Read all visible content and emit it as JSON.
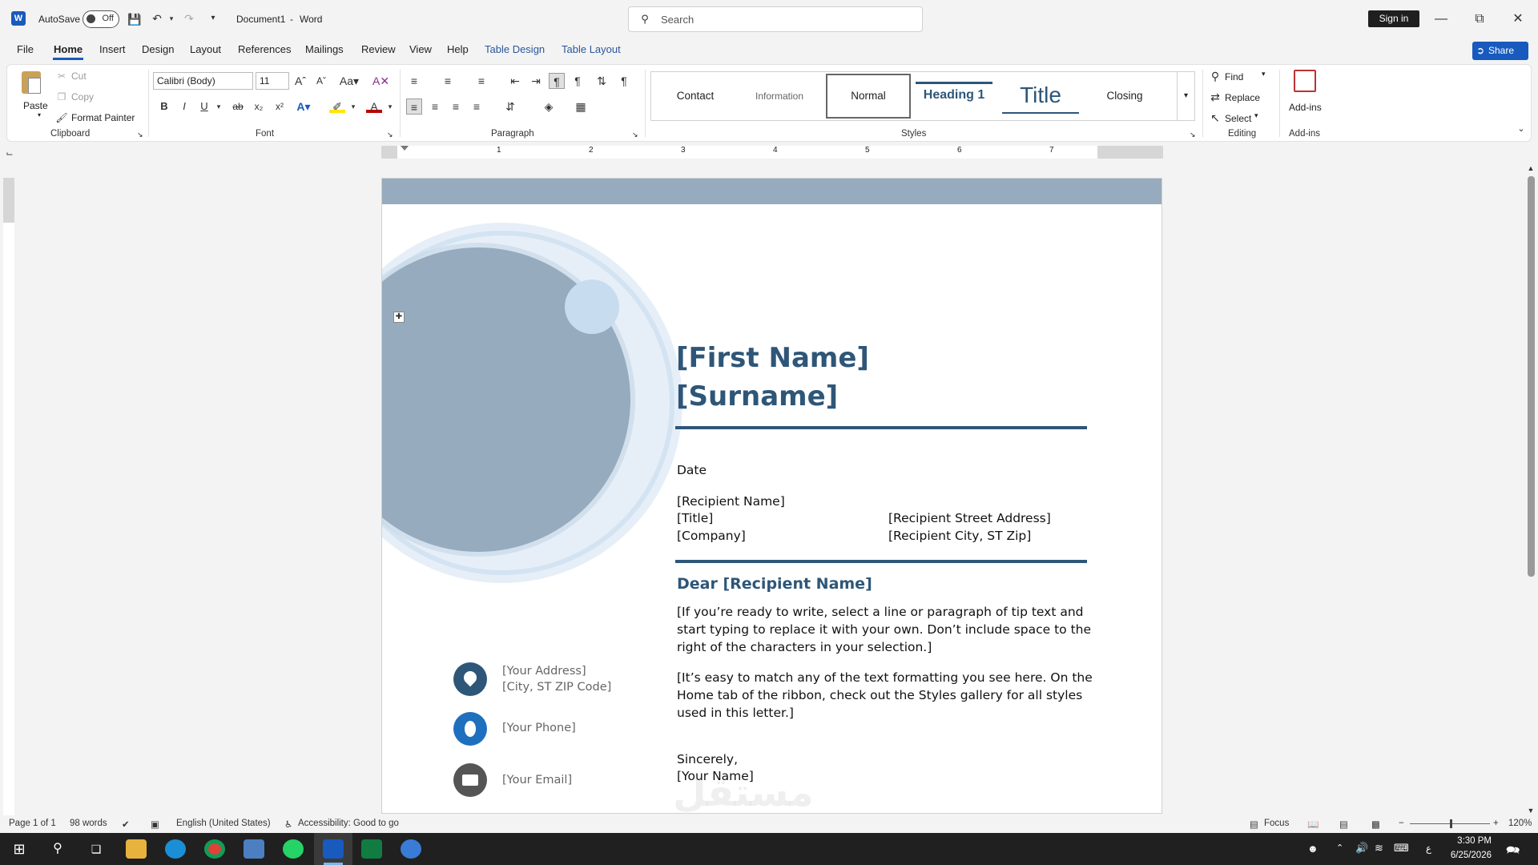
{
  "titlebar": {
    "autosave_label": "AutoSave",
    "autosave_state": "Off",
    "doc_title": "Document1",
    "app_name": "Word",
    "search_placeholder": "Search",
    "signin_label": "Sign in"
  },
  "menu": {
    "tabs": [
      "File",
      "Home",
      "Insert",
      "Design",
      "Layout",
      "References",
      "Mailings",
      "Review",
      "View",
      "Help",
      "Table Design",
      "Table Layout"
    ],
    "active": "Home",
    "share_label": "Share"
  },
  "ribbon": {
    "clipboard": {
      "paste": "Paste",
      "cut": "Cut",
      "copy": "Copy",
      "format_painter": "Format Painter",
      "group": "Clipboard"
    },
    "font": {
      "family": "Calibri (Body)",
      "size": "11",
      "group": "Font"
    },
    "paragraph": {
      "group": "Paragraph"
    },
    "styles": {
      "items": [
        "Contact",
        "Information",
        "Normal",
        "Heading 1",
        "Title",
        "Closing"
      ],
      "group": "Styles"
    },
    "editing": {
      "find": "Find",
      "replace": "Replace",
      "select": "Select",
      "group": "Editing"
    },
    "addins": {
      "label": "Add-ins",
      "group": "Add-ins"
    }
  },
  "ruler": {
    "numbers": [
      "1",
      "2",
      "3",
      "4",
      "5",
      "6",
      "7"
    ]
  },
  "document": {
    "first_name": "[First Name]",
    "surname": "[Surname]",
    "date": "Date",
    "recipient_name": "[Recipient Name]",
    "title": "[Title]",
    "company": "[Company]",
    "street": "[Recipient Street Address]",
    "city": "[Recipient City, ST Zip]",
    "greeting": "Dear [Recipient Name]",
    "para1": "[If you’re ready to write, select a line or paragraph of tip text and start typing to replace it with your own. Don’t include space to the right of the characters in your selection.]",
    "para2": "[It’s easy to match any of the text formatting you see here. On the Home tab of the ribbon, check out the Styles gallery for all styles used in this letter.]",
    "closing": "Sincerely,",
    "your_name": "[Your Name]",
    "address": "[Your Address]",
    "city_zip": "[City, ST ZIP Code]",
    "phone": "[Your Phone]",
    "email": "[Your Email]"
  },
  "statusbar": {
    "page": "Page 1 of 1",
    "words": "98 words",
    "language": "English (United States)",
    "accessibility": "Accessibility: Good to go",
    "focus": "Focus",
    "zoom": "120%"
  },
  "taskbar": {
    "time": "3:30 PM",
    "date": "6/25/2026",
    "lang_indicator": "ع"
  },
  "watermark": "مستقل\nmostaql.com",
  "colors": {
    "accent": "#2e5678",
    "band": "#96abbd",
    "brand": "#185abd"
  }
}
